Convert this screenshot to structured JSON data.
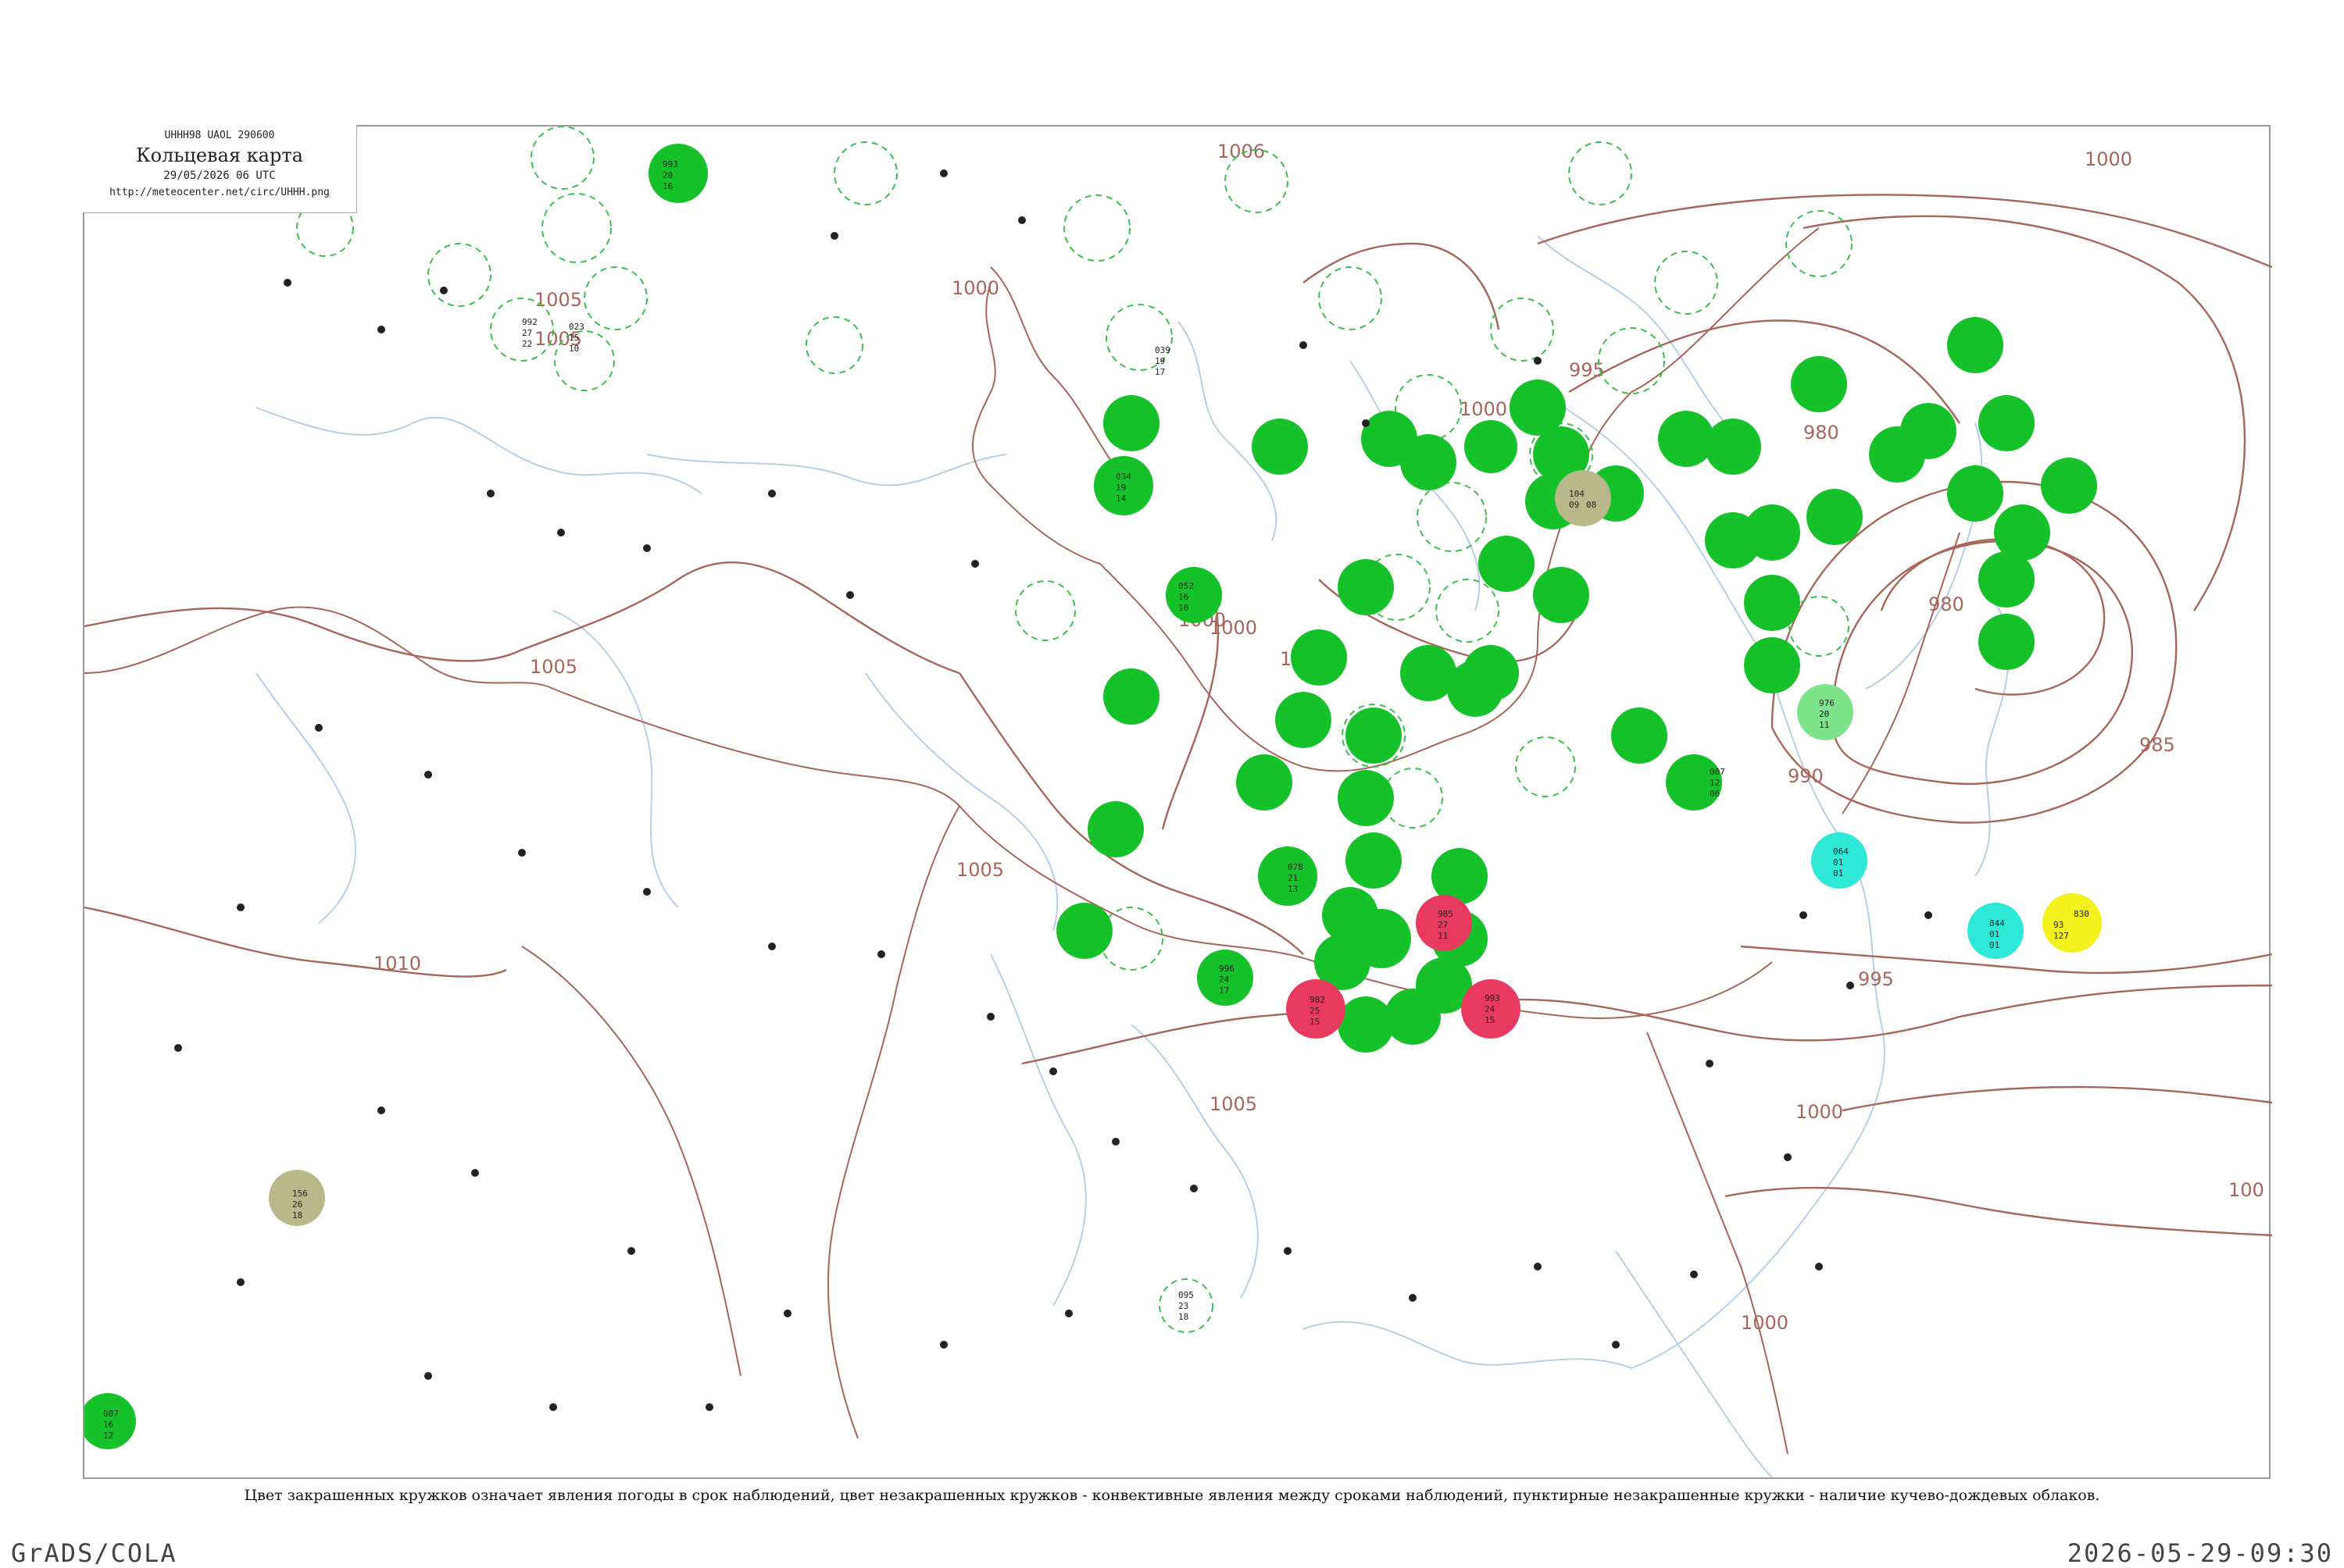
{
  "title_box": {
    "header": "UHHH98  UAOL  290600",
    "title": "Кольцевая карта",
    "datetime": "29/05/2026 06 UTC",
    "url": "http://meteocenter.net/circ/UHHH.png"
  },
  "caption": "Цвет закрашенных кружков означает явления погоды в срок наблюдений, цвет незакрашенных кружков - конвективные явления между сроками наблюдений, пунктирные незакрашенные кружки - наличие кучево-дождевых облаков.",
  "footer": {
    "left": "GrADS/COLA",
    "right": "2026-05-29-09:30"
  },
  "colors": {
    "isobar": "#a8655a",
    "river": "#b5cfe8",
    "rain_green": "#16c22a",
    "shower_green_light": "#7ee38a",
    "thunder_red": "#e83a5f",
    "fog_olive": "#b8b88a",
    "snow_cyan": "#2ee8d8",
    "sand_yellow": "#f4f21c",
    "cb_dashed_green": "#3cbf4c"
  },
  "isobar_labels": [
    "1005",
    "1000",
    "995",
    "990",
    "985",
    "980",
    "1010",
    "1005",
    "1000"
  ],
  "isobar_label_list": [
    {
      "text": "1005"
    },
    {
      "text": "1000"
    },
    {
      "text": "1005"
    },
    {
      "text": "1000"
    },
    {
      "text": "1000"
    },
    {
      "text": "995"
    },
    {
      "text": "980"
    },
    {
      "text": "980"
    },
    {
      "text": "985"
    },
    {
      "text": "990"
    },
    {
      "text": "995"
    },
    {
      "text": "1000"
    },
    {
      "text": "1005"
    },
    {
      "text": "1010"
    },
    {
      "text": "1005"
    },
    {
      "text": "1000"
    },
    {
      "text": "100"
    },
    {
      "text": "1005"
    },
    {
      "text": "1000"
    },
    {
      "text": "1006"
    },
    {
      "text": "1000"
    },
    {
      "text": "1000"
    }
  ],
  "stations": [
    {
      "p": "993",
      "t": "20",
      "td": "16",
      "w": "rain"
    },
    {
      "p": "992",
      "t": "27",
      "td": "22",
      "w": "rain"
    },
    {
      "p": "023",
      "t": "15",
      "td": "10",
      "w": "rain"
    },
    {
      "p": "039",
      "t": "19",
      "td": "17",
      "w": "rain"
    },
    {
      "p": "034",
      "t": "19",
      "td": "14",
      "w": "rain"
    },
    {
      "p": "052",
      "t": "16",
      "td": "10",
      "w": "rain"
    },
    {
      "p": "078",
      "t": "21",
      "td": "13",
      "w": "rain"
    },
    {
      "p": "095",
      "t": "23",
      "td": "18",
      "w": "rain"
    },
    {
      "p": "007",
      "t": "12",
      "td": "06",
      "w": "rain"
    },
    {
      "p": "982",
      "t": "25",
      "td": "15",
      "w": "thunder"
    },
    {
      "p": "985",
      "t": "27",
      "td": "11",
      "w": "thunder"
    },
    {
      "p": "993",
      "t": "24",
      "td": "15",
      "w": "thunder"
    },
    {
      "p": "104",
      "t": "09",
      "td": "08",
      "w": "fog"
    },
    {
      "p": "156",
      "t": "26",
      "td": "18",
      "w": "fog"
    },
    {
      "p": "064",
      "t": "01",
      "td": "01",
      "w": "snow"
    },
    {
      "p": "844",
      "t": "01",
      "td": "01",
      "w": "snow"
    },
    {
      "p": "830",
      "t": "93",
      "td": "127",
      "w": "sand"
    },
    {
      "p": "976",
      "t": "20",
      "td": "11",
      "w": "shower"
    },
    {
      "p": "007",
      "t": "16",
      "td": "12",
      "w": "rain"
    },
    {
      "p": "996",
      "t": "24",
      "td": "17",
      "w": "rain"
    }
  ]
}
